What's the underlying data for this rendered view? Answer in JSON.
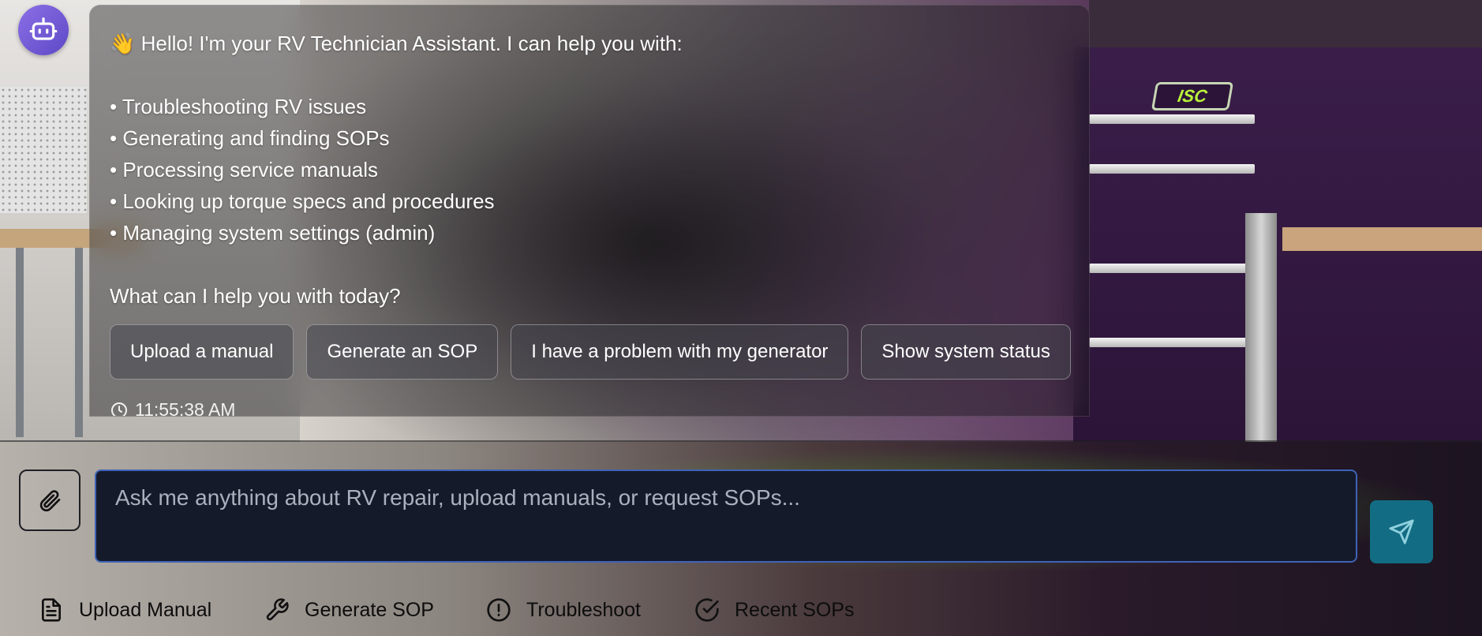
{
  "assistant": {
    "avatar_icon": "robot-icon",
    "avatar_color": "#6f58d8"
  },
  "message": {
    "greeting_emoji": "👋",
    "greeting": "Hello! I'm your RV Technician Assistant. I can help you with:",
    "capabilities": [
      "• Troubleshooting RV issues",
      "• Generating and finding SOPs",
      "• Processing service manuals",
      "• Looking up torque specs and procedures",
      "• Managing system settings (admin)"
    ],
    "prompt": "What can I help you with today?",
    "quick_replies": [
      "Upload a manual",
      "Generate an SOP",
      "I have a problem with my generator",
      "Show system status"
    ],
    "timestamp": "11:55:38 AM"
  },
  "composer": {
    "placeholder": "Ask me anything about RV repair, upload manuals, or request SOPs...",
    "value": "",
    "attach_icon": "paperclip-icon",
    "send_icon": "send-icon",
    "send_color": "#126c83",
    "input_border_color": "#3f63b8"
  },
  "actions": [
    {
      "label": "Upload Manual",
      "icon": "document-icon"
    },
    {
      "label": "Generate SOP",
      "icon": "wrench-icon"
    },
    {
      "label": "Troubleshoot",
      "icon": "alert-circle-icon"
    },
    {
      "label": "Recent SOPs",
      "icon": "check-circle-icon"
    }
  ],
  "background": {
    "logo_text": "ISC"
  }
}
